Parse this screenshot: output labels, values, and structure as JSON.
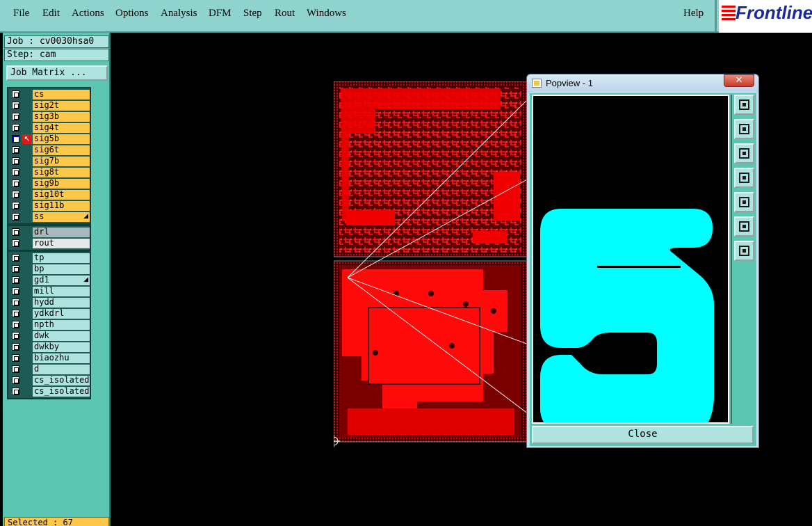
{
  "menu": {
    "items": [
      "File",
      "Edit",
      "Actions",
      "Options",
      "Analysis",
      "DFM",
      "Step",
      "Rout",
      "Windows"
    ],
    "help": "Help"
  },
  "logo": {
    "text": "Frontline"
  },
  "job": {
    "label": "Job : cv0030hsa0",
    "step": "Step: cam",
    "matrix_button": "Job Matrix ..."
  },
  "layers": {
    "signal": [
      "cs",
      "sig2t",
      "sig3b",
      "sig4t",
      "sig5b",
      "sig6t",
      "sig7b",
      "sig8t",
      "sig9b",
      "sig10t",
      "sig11b",
      "ss"
    ],
    "drill": [
      "drl",
      "rout"
    ],
    "misc": [
      "tp",
      "bp",
      "gd1",
      "mill",
      "hydd",
      "ydkdrl",
      "npth",
      "dwk",
      "dwkby",
      "biaozhu",
      "d",
      "cs_isolated",
      "cs_isolated"
    ]
  },
  "selected": "Selected : 67",
  "popview": {
    "title": "Popview - 1",
    "close_x": "✕",
    "close_button": "Close",
    "digit_shown": "5",
    "digit_color": "#00ffff"
  },
  "colors": {
    "menubar": "#8fd3cf",
    "panel": "#5cc6b2",
    "layer_signal": "#ffc84a",
    "board": "#e00000"
  }
}
